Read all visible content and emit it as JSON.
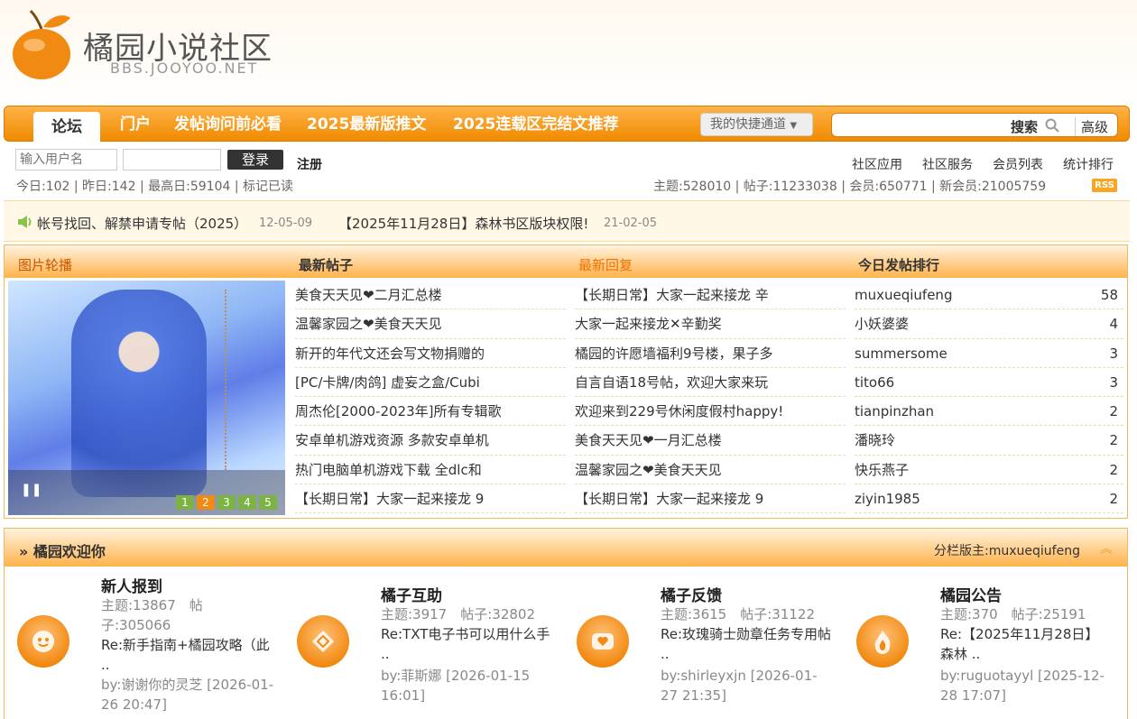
{
  "site": {
    "name": "橘园小说社区",
    "domain": "BBS.JOOYOO.NET",
    "accent": "#f08a00"
  },
  "nav": {
    "active_tab": "论坛",
    "tabs": [
      "门户",
      "发帖询问前必看",
      "2025最新版推文",
      "2025连载区完结文推荐"
    ],
    "quick_menu": "我的快捷通道",
    "search_label": "搜索",
    "advanced": "高级"
  },
  "login": {
    "username_placeholder": "输入用户名",
    "button": "登录",
    "register": "注册"
  },
  "links": [
    "社区应用",
    "社区服务",
    "会员列表",
    "统计排行"
  ],
  "stats": {
    "left": "今日:102 | 昨日:142 | 最高日:59104 | 标记已读",
    "right": "主题:528010 | 帖子:11233038 | 会员:650771 | 新会员:21005759",
    "rss": "RSS"
  },
  "announcements": [
    {
      "title": "帐号找回、解禁申请专帖（2025）",
      "date": "12-05-09"
    },
    {
      "title": "【2025年11月28日】森林书区版块权限!",
      "date": "21-02-05"
    }
  ],
  "panel": {
    "headers": [
      "图片轮播",
      "最新帖子",
      "最新回复",
      "今日发帖排行"
    ],
    "slide_pages": [
      "1",
      "2",
      "3",
      "4",
      "5"
    ],
    "latest_posts": [
      "美食天天见❤二月汇总楼",
      "温馨家园之❤美食天天见",
      "新开的年代文还会写文物捐赠的",
      "[PC/卡牌/肉鸽] 虚妄之盒/Cubi",
      "周杰伦[2000-2023年]所有专辑歌",
      "安卓单机游戏资源 多款安卓单机",
      "热门电脑单机游戏下载 全dlc和",
      "【长期日常】大家一起来接龙 9"
    ],
    "latest_replies": [
      "【长期日常】大家一起来接龙 辛",
      "大家一起来接龙✕辛勤奖",
      "橘园的许愿墙福利9号楼，果子多",
      "自言自语18号帖，欢迎大家来玩",
      "欢迎来到229号休闲度假村happy!",
      "美食天天见❤一月汇总楼",
      "温馨家园之❤美食天天见",
      "【长期日常】大家一起来接龙 9"
    ],
    "ranking": [
      {
        "user": "muxueqiufeng",
        "count": "58"
      },
      {
        "user": "小妖婆婆",
        "count": "4"
      },
      {
        "user": "summersome",
        "count": "3"
      },
      {
        "user": "tito66",
        "count": "3"
      },
      {
        "user": "tianpinzhan",
        "count": "2"
      },
      {
        "user": "潘晓玲",
        "count": "2"
      },
      {
        "user": "快乐燕子",
        "count": "2"
      },
      {
        "user": "ziyin1985",
        "count": "2"
      }
    ]
  },
  "welcome": {
    "title": "橘园欢迎你",
    "moderator": "分栏版主:muxueqiufeng",
    "forums": [
      {
        "name": "新人报到",
        "meta": "主题:13867　帖子:305066",
        "last": "Re:新手指南+橘园攻略（此 ..",
        "by": "by:谢谢你的灵芝 [2026-01-26 20:47]",
        "icon": "smile-icon"
      },
      {
        "name": "橘子互助",
        "meta": "主题:3917　帖子:32802",
        "last": "Re:TXT电子书可以用什么手 ..",
        "by": "by:菲斯娜 [2026-01-15 16:01]",
        "icon": "diamond-icon"
      },
      {
        "name": "橘子反馈",
        "meta": "主题:3615　帖子:31122",
        "last": "Re:玫瑰骑士勋章任务专用帖 ..",
        "by": "by:shirleyxjn [2026-01-27 21:35]",
        "icon": "heart-chat-icon"
      },
      {
        "name": "橘园公告",
        "meta": "主题:370　帖子:25191",
        "last": "Re:【2025年11月28日】森林 ..",
        "by": "by:ruguotayyl [2025-12-28 17:07]",
        "icon": "flame-icon"
      }
    ]
  }
}
